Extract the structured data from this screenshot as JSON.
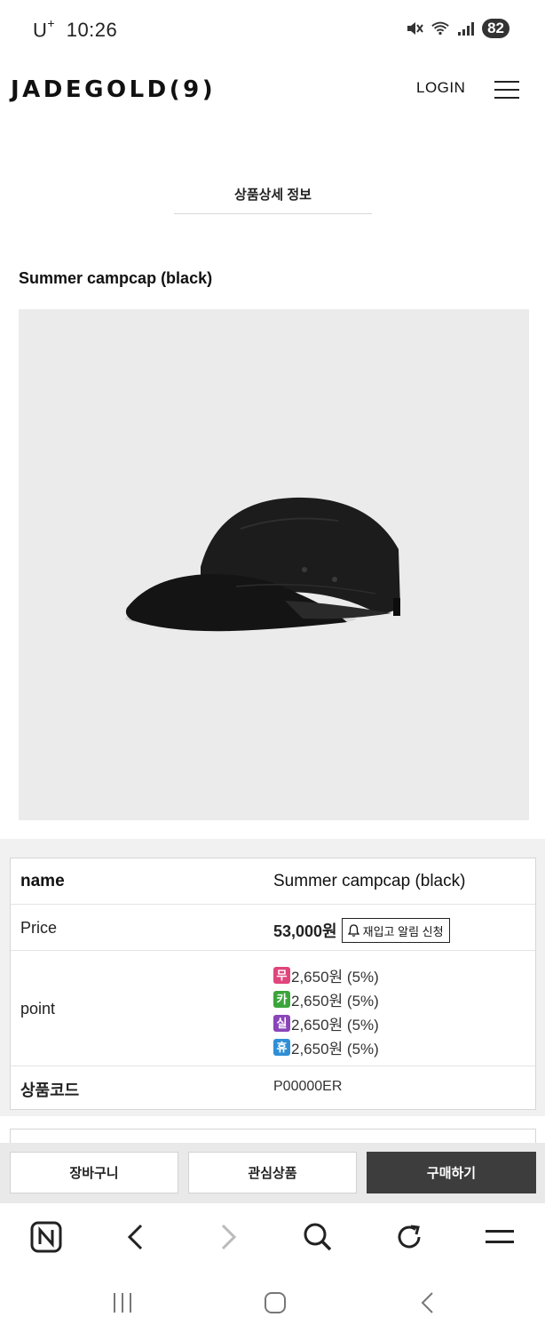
{
  "status_bar": {
    "carrier": "U",
    "carrier_sup": "+",
    "time": "10:26",
    "battery": "82",
    "icons": [
      "mute-icon",
      "wifi-icon",
      "signal-icon"
    ]
  },
  "header": {
    "logo": "JADEGOLD(9)",
    "login": "LOGIN",
    "menu_icon": "hamburger-menu-icon"
  },
  "section_tab": "상품상세 정보",
  "product": {
    "title": "Summer campcap (black)",
    "image_alt": "black camp cap"
  },
  "info": {
    "name_label": "name",
    "name_value": "Summer campcap (black)",
    "price_label": "Price",
    "price_value": "53,000원",
    "restock_button": "재입고 알림 신청",
    "point_label": "point",
    "points": [
      {
        "badge": "무",
        "color": "#e0457b",
        "text": "2,650원 (5%)"
      },
      {
        "badge": "카",
        "color": "#3aa53a",
        "text": "2,650원 (5%)"
      },
      {
        "badge": "실",
        "color": "#8a45b8",
        "text": "2,650원 (5%)"
      },
      {
        "badge": "휴",
        "color": "#2f8fd6",
        "text": "2,650원 (5%)"
      }
    ],
    "code_label": "상품코드",
    "code_value": "P00000ER"
  },
  "actions": {
    "cart": "장바구니",
    "wishlist": "관심상품",
    "buy": "구매하기"
  },
  "browser_bar": {
    "items": [
      "naver-home-icon",
      "back-icon",
      "forward-icon",
      "search-icon",
      "refresh-icon",
      "menu-icon"
    ]
  },
  "system_nav": {
    "items": [
      "recent-apps-icon",
      "home-icon",
      "back-icon"
    ]
  }
}
